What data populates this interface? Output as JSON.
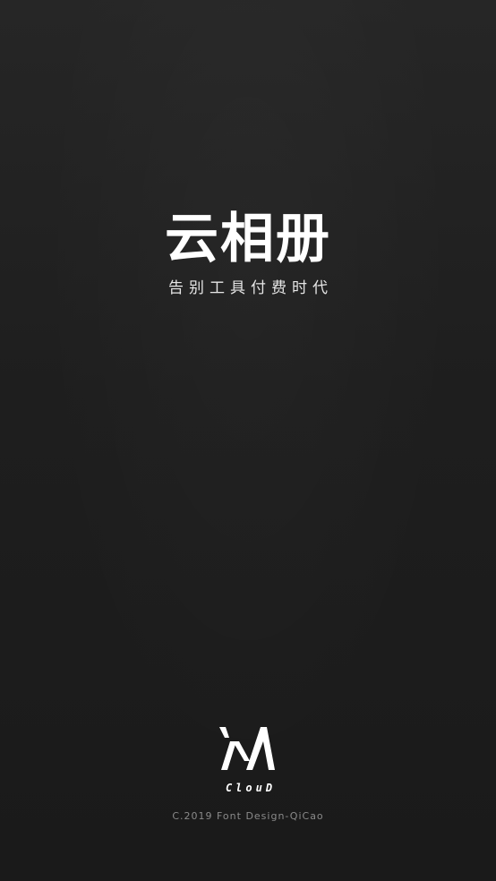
{
  "splash": {
    "app_title": "云相册",
    "tagline": "告别工具付费时代",
    "logo": {
      "icon": "cloud-m-logo-icon",
      "wordmark": "ClouD"
    },
    "copyright": "C.2019 Font Design-QiCao"
  },
  "colors": {
    "background": "#1e1e1e",
    "title": "#ffffff",
    "tagline": "#e6e6e6",
    "copyright": "#8a8a8a"
  }
}
